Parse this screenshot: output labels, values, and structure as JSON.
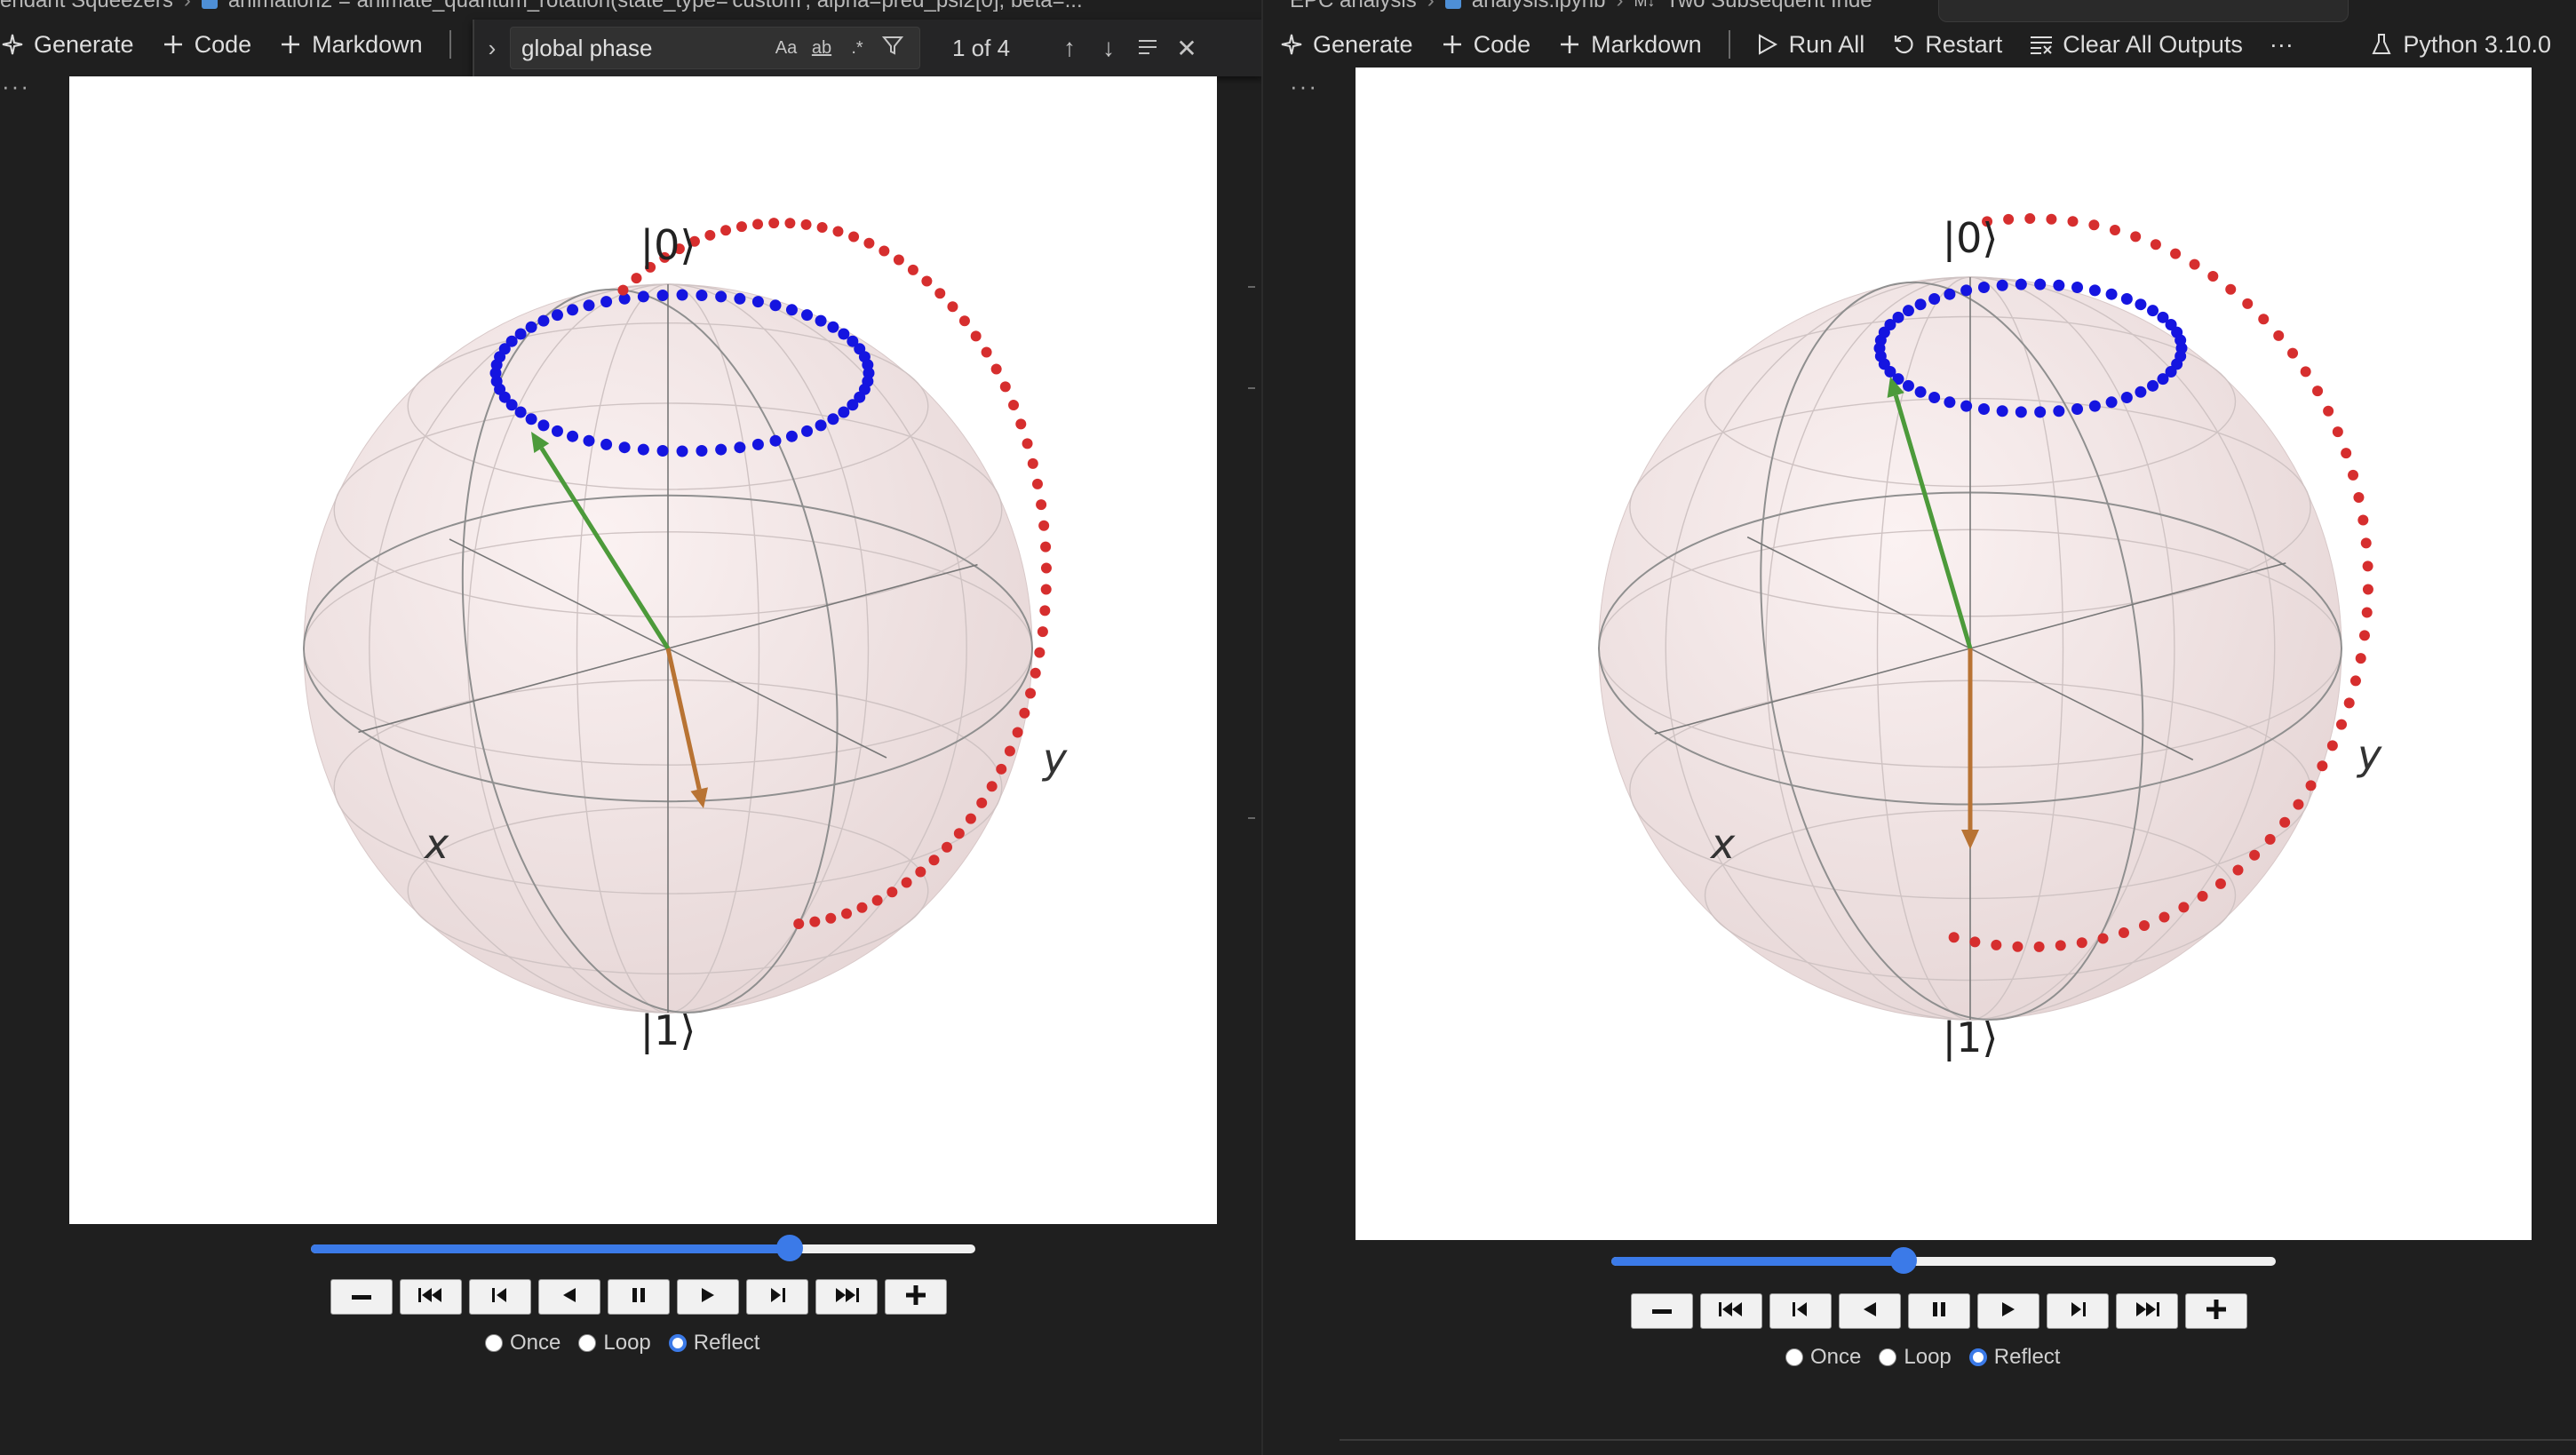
{
  "left": {
    "breadcrumb": [
      "endant Squeezers",
      "animation2 = animate_quantum_rotation(state_type='custom', alpha=pred_psi2[0], beta=..."
    ],
    "toolbar": {
      "generate": "Generate",
      "code": "Code",
      "markdown": "Markdown"
    },
    "find": {
      "query": "global phase",
      "match_case": "Aa",
      "whole_word": "ab",
      "regex": ".*",
      "result": "1 of 4"
    },
    "sphere": {
      "north": "|0⟩",
      "south": "|1⟩",
      "x_label": "x",
      "y_label": "y"
    },
    "slider_fraction": 0.72,
    "loop": {
      "once": "Once",
      "loop": "Loop",
      "reflect": "Reflect",
      "selected": "reflect"
    }
  },
  "right": {
    "breadcrumb": [
      "EPC analysis",
      "analysis.ipynb",
      "M↓",
      "Two Subsequent Inde"
    ],
    "toolbar": {
      "generate": "Generate",
      "code": "Code",
      "markdown": "Markdown",
      "run_all": "Run All",
      "restart": "Restart",
      "clear_outputs": "Clear All Outputs",
      "more": "···",
      "kernel": "Python 3.10.0"
    },
    "sphere": {
      "north": "|0⟩",
      "south": "|1⟩",
      "x_label": "x",
      "y_label": "y"
    },
    "slider_fraction": 0.44,
    "loop": {
      "once": "Once",
      "loop": "Loop",
      "reflect": "Reflect",
      "selected": "reflect"
    }
  },
  "more_dots": "···",
  "colors": {
    "blue_points": "#1515e0",
    "red_points": "#d62e2e",
    "green_arrow": "#4c9a3a",
    "orange_arrow": "#b87333",
    "sphere_fill": "#f6e6e6",
    "accent": "#3b7ae8"
  }
}
